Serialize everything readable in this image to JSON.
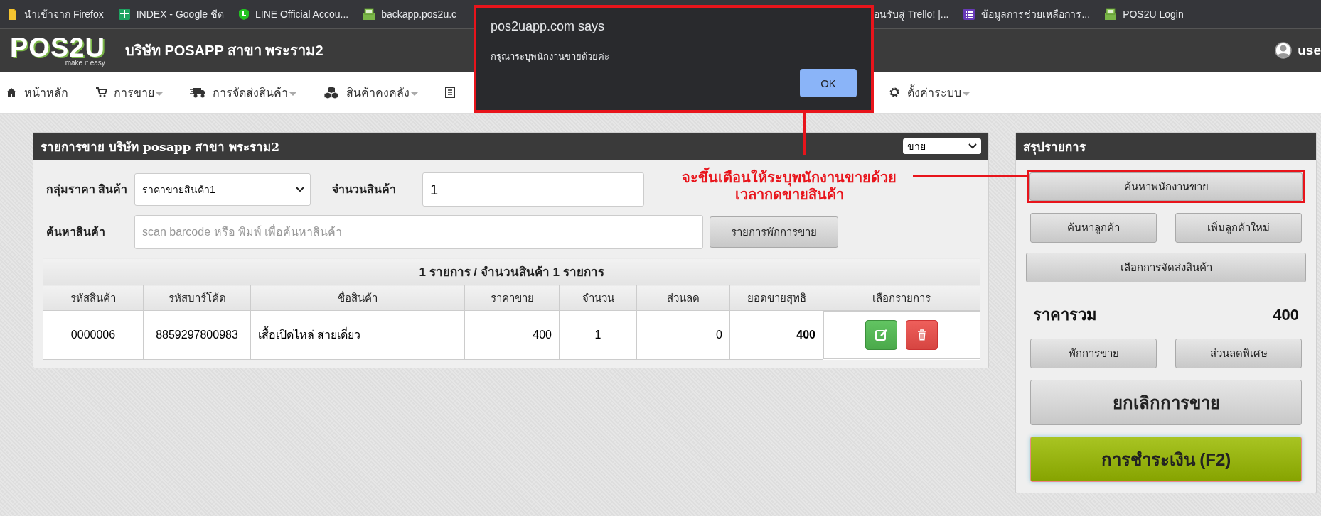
{
  "bookmarks": [
    {
      "label": "นำเข้าจาก Firefox"
    },
    {
      "label": "INDEX - Google ชีต"
    },
    {
      "label": "LINE Official Accou..."
    },
    {
      "label": "backapp.pos2u.c"
    },
    {
      "label": "อนรับสู่ Trello! |..."
    },
    {
      "label": "ข้อมูลการช่วยเหลือการ..."
    },
    {
      "label": "POS2U Login"
    }
  ],
  "header": {
    "logo": "POS2U",
    "tagline": "make it easy",
    "company": "บริษัท POSAPP สาขา พระราม2",
    "user": "use"
  },
  "nav": [
    {
      "label": "หน้าหลัก",
      "dropdown": false
    },
    {
      "label": "การขาย",
      "dropdown": true
    },
    {
      "label": "การจัดส่งสินค้า",
      "dropdown": true
    },
    {
      "label": "สินค้าคงคลัง",
      "dropdown": true
    },
    {
      "dropdown": false
    },
    {
      "label": "ตั้งค่าระบบ",
      "dropdown": true
    }
  ],
  "sale_panel": {
    "title": "รายการขาย บริษัท posapp สาขา พระราม2",
    "mode": "ขาย",
    "price_group": {
      "label": "กลุ่มราคา สินค้า",
      "value": "ราคาขายสินค้า1"
    },
    "quantity": {
      "label": "จำนวนสินค้า",
      "value": "1"
    },
    "search": {
      "label": "ค้นหาสินค้า",
      "placeholder": "scan barcode หรือ พิมพ์ เพื่อค้นหาสินค้า"
    },
    "held_button": "รายการพักการขาย",
    "table": {
      "caption": "1 รายการ / จำนวนสินค้า 1 รายการ",
      "columns": [
        "รหัสสินค้า",
        "รหัสบาร์โค้ด",
        "ชื่อสินค้า",
        "ราคาขาย",
        "จำนวน",
        "ส่วนลด",
        "ยอดขายสุทธิ",
        "เลือกรายการ"
      ],
      "rows": [
        {
          "cells": [
            "0000006",
            "8859297800983",
            "เสื้อเปิดไหล่ สายเดี่ยว",
            "400",
            "1",
            "0",
            "400"
          ]
        }
      ]
    }
  },
  "summary_panel": {
    "title": "สรุปรายการ",
    "buttons_top": [
      {
        "label": "ค้นหาพนักงานขาย",
        "kind": "full",
        "highlighted": true
      },
      {
        "label": "ค้นหาลูกค้า",
        "kind": "half",
        "highlighted": false
      },
      {
        "label": "เพิ่มลูกค้าใหม่",
        "kind": "half",
        "highlighted": false
      },
      {
        "label": "เลือกการจัดส่งสินค้า",
        "kind": "full",
        "highlighted": false
      }
    ],
    "total_label": "ราคารวม",
    "total": "400",
    "buttons_bottom": [
      {
        "label": "พักการขาย",
        "kind": "half",
        "highlighted": false
      },
      {
        "label": "ส่วนลดพิเศษ",
        "kind": "half",
        "highlighted": false
      },
      {
        "label": "ยกเลิกการขาย",
        "kind": "large",
        "highlighted": false
      },
      {
        "label": "การชำระเงิน (F2)",
        "kind": "pay",
        "highlighted": false
      }
    ]
  },
  "dialog": {
    "title": "pos2uapp.com says",
    "message": "กรุณาระบุพนักงานขายด้วยค่ะ",
    "button": "OK"
  },
  "annotation": {
    "text": "จะขึ้นเตือนให้ระบุพนักงานขายด้วย\nเวลากดขายสินค้า"
  }
}
